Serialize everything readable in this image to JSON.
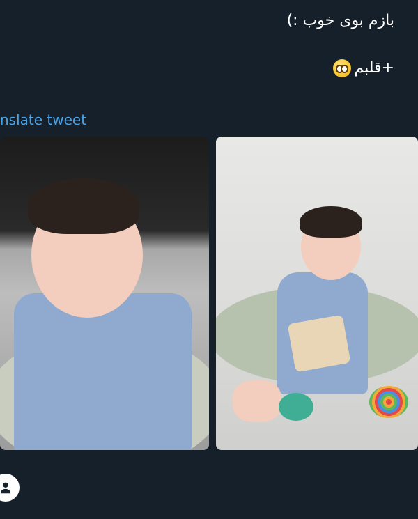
{
  "tweet": {
    "line1": "بازم بوی خوب :)",
    "line2": "+قلبم",
    "emoji": "pleading-face-icon"
  },
  "translate_link": "nslate tweet",
  "colors": {
    "background": "#15202b",
    "link": "#4aa3e6",
    "text": "#ffffff"
  },
  "media": {
    "photos": [
      {
        "subject": "baby in blue shirt sitting"
      },
      {
        "subject": "smiling baby holding picture frame with toys"
      }
    ]
  },
  "bottom_icon": "account-icon"
}
